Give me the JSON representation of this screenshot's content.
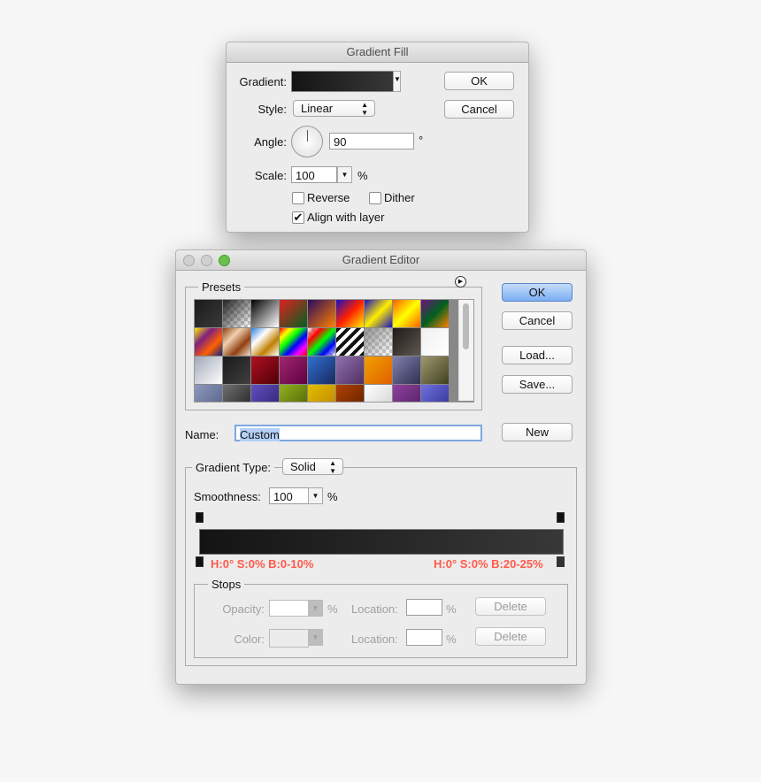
{
  "gradient_fill": {
    "title": "Gradient Fill",
    "gradient_label": "Gradient:",
    "style_label": "Style:",
    "style_value": "Linear",
    "angle_label": "Angle:",
    "angle_value": "90",
    "angle_unit": "°",
    "scale_label": "Scale:",
    "scale_value": "100",
    "scale_unit": "%",
    "reverse_label": "Reverse",
    "reverse_checked": false,
    "dither_label": "Dither",
    "dither_checked": false,
    "align_label": "Align with layer",
    "align_checked": true,
    "ok": "OK",
    "cancel": "Cancel"
  },
  "gradient_editor": {
    "title": "Gradient Editor",
    "presets_label": "Presets",
    "ok": "OK",
    "cancel": "Cancel",
    "load": "Load...",
    "save": "Save...",
    "name_label": "Name:",
    "name_value": "Custom",
    "new": "New",
    "type_label": "Gradient Type:",
    "type_value": "Solid",
    "smoothness_label": "Smoothness:",
    "smoothness_value": "100",
    "smoothness_unit": "%",
    "left_annotation": "H:0° S:0% B:0-10%",
    "right_annotation": "H:0° S:0% B:20-25%",
    "annotation_color": "#ff5a4a",
    "gradient_colors": [
      "#141414",
      "#383838"
    ],
    "stops": {
      "label": "Stops",
      "opacity_label": "Opacity:",
      "opacity_unit": "%",
      "location_label": "Location:",
      "location_unit": "%",
      "color_label": "Color:",
      "delete": "Delete"
    },
    "presets": [
      [
        "#1a1a1a",
        "#3a3a3a"
      ],
      [
        "#222222",
        "checker"
      ],
      [
        "#000000",
        "#ffffff"
      ],
      [
        "#e02020",
        "#006020"
      ],
      [
        "#2a0a60",
        "#ff8000"
      ],
      [
        "#1a10c0",
        "#ff2000",
        "#ffee00"
      ],
      [
        "#1a10c0",
        "#ffee00",
        "#1a10c0"
      ],
      [
        "#ff6000",
        "#ffff00",
        "#ff6000"
      ],
      [
        "#701080",
        "#006020",
        "#ff8000"
      ],
      [
        "#ffee00",
        "#802080",
        "#ff6000",
        "#102080"
      ],
      [
        "#904010",
        "#f0d0b0",
        "#904010",
        "#f0e0d0"
      ],
      [
        "#3080e0",
        "#ffffff",
        "#c08000",
        "#ffffff"
      ],
      [
        "#ff0000",
        "#ffff00",
        "#00ff00",
        "#0000ff",
        "#ff00ff",
        "#ff0000"
      ],
      [
        "checker",
        "#ff0000",
        "#00ff00",
        "#0000ff",
        "checker"
      ],
      [
        "stripes"
      ],
      [
        "checker2"
      ],
      [
        "#1e1a18",
        "#605850"
      ],
      [
        "#f0f0f0",
        "#ffffff"
      ],
      [
        "#a0a8b8",
        "#ffffff"
      ],
      [
        "#1a1a1a",
        "#404040"
      ],
      [
        "#b01020",
        "#500008"
      ],
      [
        "#a02870",
        "#600040"
      ],
      [
        "#3070d0",
        "#182860"
      ],
      [
        "#9070b0",
        "#503060"
      ],
      [
        "#f0a000",
        "#e06000"
      ],
      [
        "#8080b0",
        "#303050"
      ],
      [
        "#a09870",
        "#404020"
      ],
      [
        "#9098c0",
        "#506080"
      ],
      [
        "#707070",
        "#202020"
      ],
      [
        "#6050c0",
        "#302070"
      ],
      [
        "#90b020",
        "#506000"
      ],
      [
        "#e0c000",
        "#c08000"
      ],
      [
        "#b04000",
        "#602000"
      ],
      [
        "#ffffff",
        "#d0d0d0"
      ],
      [
        "#9040a0",
        "#502060"
      ],
      [
        "#7070e0",
        "#303090"
      ]
    ]
  }
}
